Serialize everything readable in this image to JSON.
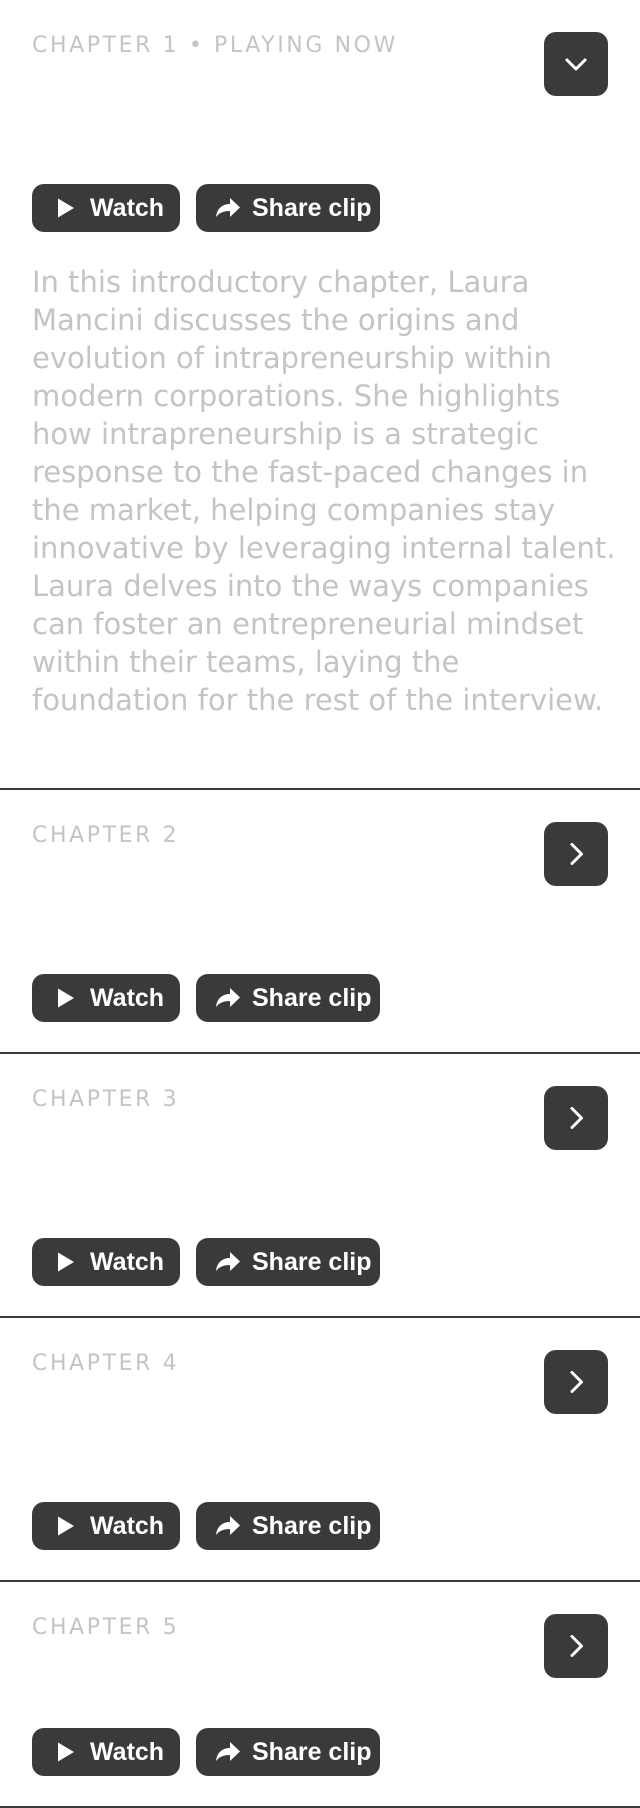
{
  "chapters": [
    {
      "label": "CHAPTER 1 • PLAYING NOW",
      "expanded": true,
      "toggle_icon": "chevron-down-icon",
      "watch_label": "Watch",
      "share_label": "Share clip",
      "description": "In this introductory chapter, Laura Mancini discusses the origins and evolution of intrapreneurship within modern corporations. She highlights how intrapreneurship is a strategic response to the fast-paced changes in the market, helping companies stay innovative by leveraging internal talent. Laura delves into the ways companies can foster an entrepreneurial mindset within their teams, laying the foundation for the rest of the interview."
    },
    {
      "label": "CHAPTER 2",
      "expanded": false,
      "toggle_icon": "chevron-right-icon",
      "watch_label": "Watch",
      "share_label": "Share clip"
    },
    {
      "label": "CHAPTER 3",
      "expanded": false,
      "toggle_icon": "chevron-right-icon",
      "watch_label": "Watch",
      "share_label": "Share clip"
    },
    {
      "label": "CHAPTER 4",
      "expanded": false,
      "toggle_icon": "chevron-right-icon",
      "watch_label": "Watch",
      "share_label": "Share clip"
    },
    {
      "label": "CHAPTER 5",
      "expanded": false,
      "toggle_icon": "chevron-right-icon",
      "watch_label": "Watch",
      "share_label": "Share clip"
    }
  ],
  "colors": {
    "button_bg": "#3a3a3a",
    "button_text": "#ffffff",
    "muted_text": "#c4c4c4",
    "divider": "#3a3a3a",
    "page_bg": "#ffffff"
  },
  "icons": {
    "watch": "play-icon",
    "share": "share-arrow-icon"
  }
}
